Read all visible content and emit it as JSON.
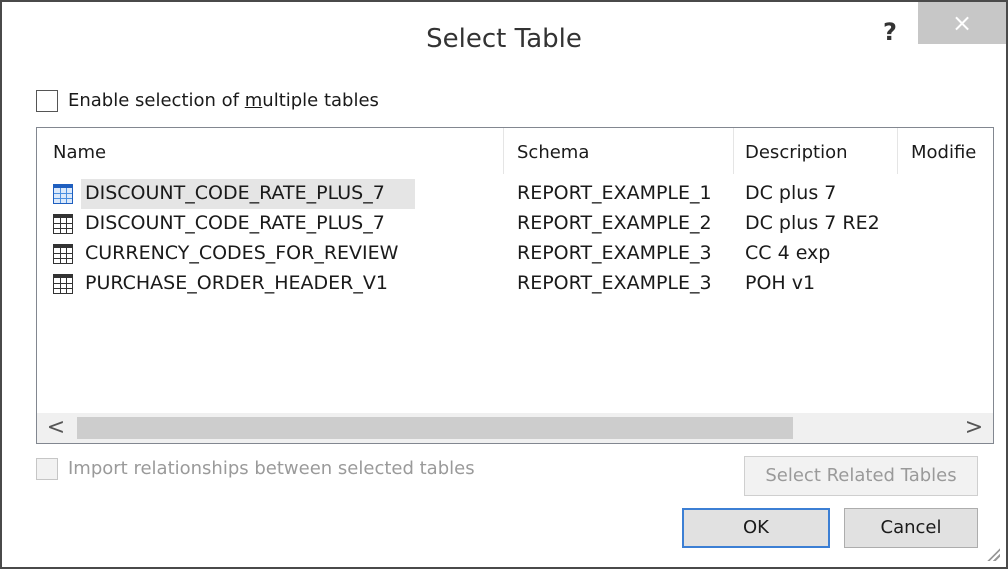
{
  "dialog": {
    "title": "Select Table",
    "help": "?",
    "close": "×"
  },
  "multi_select": {
    "label_before": "Enable selection of ",
    "label_hotkey": "m",
    "label_after": "ultiple tables",
    "checked": false
  },
  "table": {
    "columns": [
      "Name",
      "Schema",
      "Description",
      "Modifie"
    ],
    "rows": [
      {
        "name": "DISCOUNT_CODE_RATE_PLUS_7",
        "schema": "REPORT_EXAMPLE_1",
        "description": "DC plus 7",
        "selected": true,
        "icon": "table-icon-blue"
      },
      {
        "name": "DISCOUNT_CODE_RATE_PLUS_7",
        "schema": "REPORT_EXAMPLE_2",
        "description": "DC plus 7 RE2",
        "selected": false,
        "icon": "table-icon"
      },
      {
        "name": "CURRENCY_CODES_FOR_REVIEW",
        "schema": "REPORT_EXAMPLE_3",
        "description": "CC 4 exp",
        "selected": false,
        "icon": "table-icon"
      },
      {
        "name": "PURCHASE_ORDER_HEADER_V1",
        "schema": "REPORT_EXAMPLE_3",
        "description": "POH v1",
        "selected": false,
        "icon": "table-icon"
      }
    ],
    "scroll_left": "<",
    "scroll_right": ">"
  },
  "import_relationships": {
    "label": "Import relationships between selected tables",
    "checked": false,
    "enabled": false
  },
  "buttons": {
    "select_related": "Select Related Tables",
    "ok": "OK",
    "cancel": "Cancel"
  },
  "colors": {
    "accent": "#3c7fd4",
    "close_bg": "#c7c7c7",
    "selected_row": "#e5e5e5"
  }
}
